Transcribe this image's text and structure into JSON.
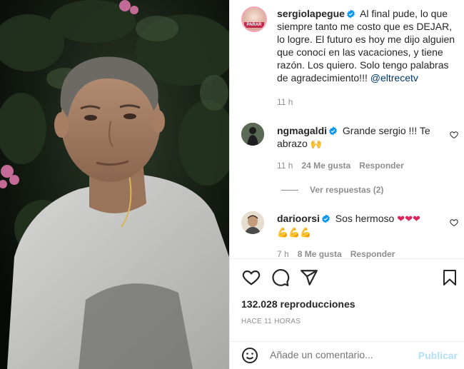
{
  "post": {
    "username": "sergiolapegue",
    "avatar_label": "PARAR",
    "caption": "Al final pude, lo que siempre tanto me costo que es DEJAR, lo logre. El futuro es hoy me dijo alguien que conocí en las vacaciones, y tiene razón. Los quiero. Solo tengo palabras de agradecimiento!!! ",
    "mention": "@eltrecetv",
    "time": "11 h"
  },
  "comments": [
    {
      "username": "ngmagaldi",
      "text": "Grande sergio !!! Te abrazo",
      "emoji": "🙌",
      "time": "11 h",
      "likes": "24 Me gusta",
      "reply": "Responder",
      "view_replies": "Ver respuestas (2)"
    },
    {
      "username": "darioorsi",
      "text": "Sos hermoso ",
      "emoji_line1": "❤❤❤",
      "emoji_line2": "💪💪💪",
      "time": "7 h",
      "likes": "8 Me gusta",
      "reply": "Responder"
    }
  ],
  "stats": {
    "views": "132.028 reproducciones",
    "ago": "HACE 11 HORAS"
  },
  "comment_box": {
    "placeholder": "Añade un comentario...",
    "publish": "Publicar"
  },
  "icons": {
    "like": "heart-icon",
    "comment": "comment-icon",
    "share": "share-icon",
    "save": "bookmark-icon",
    "emoji": "emoji-icon"
  },
  "colors": {
    "verified": "#0095f6",
    "mention": "#00376b",
    "publish_disabled": "#b2dffc",
    "muted": "#8e8e8e"
  }
}
